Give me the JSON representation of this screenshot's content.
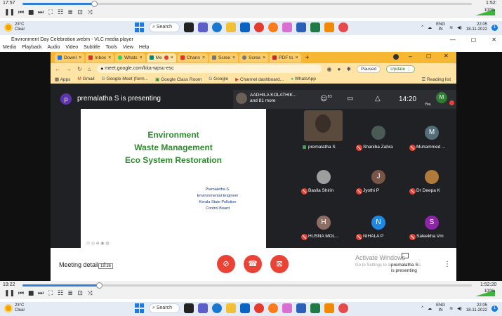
{
  "top_seek": {
    "elapsed": "17:57",
    "total": "1:52:",
    "progress": 0.16
  },
  "bottom_seek": {
    "elapsed": "19:22",
    "total": "1:52:20",
    "progress": 0.17
  },
  "volume": "100%",
  "vlc_controls": [
    "❚❚",
    "⏮",
    "■",
    "⏭",
    "⛶",
    "☷",
    "≣",
    "⊡",
    "⤨"
  ],
  "taskbar": {
    "weather_temp": "23°C",
    "weather_desc": "Clear",
    "search_label": "Search",
    "tray_lang_1": "ENG",
    "tray_lang_2": "IN",
    "clock_time": "22:05",
    "clock_date": "18-11-2022",
    "notif_count": "1"
  },
  "vlc": {
    "title": "Environment Day Celebration.webm - VLC media player",
    "menu": [
      "Media",
      "Playback",
      "Audio",
      "Video",
      "Subtitle",
      "Tools",
      "View",
      "Help"
    ],
    "win_minimize": "—",
    "win_restore": "▢",
    "win_close": "✕"
  },
  "browser": {
    "tabs": [
      "Downl",
      "Inbox",
      "Whats",
      "Me",
      "Chann",
      "Scree",
      "Scree",
      "PDF to"
    ],
    "tab_close": "×",
    "new_tab": "+",
    "url": "meet.google.com/kka-wpsu-esc",
    "paused_label": "Paused",
    "update_label": "Update",
    "bookmarks": [
      "Apps",
      "Gmail",
      "Google Meet (form...",
      "Google Class Room",
      "Google",
      "Channel dashboard...",
      "WhatsApp"
    ],
    "reading_list": "Reading list"
  },
  "meet": {
    "presenter_initial": "p",
    "presenter_label": "premalatha S is presenting",
    "top_speaker": "AADHILA KOLATHIK...",
    "top_speaker_more": "and 81 more",
    "participant_count": "83",
    "clock": "14:20",
    "you_initial": "M",
    "you_label": "You",
    "slide": {
      "title_1": "Environment",
      "title_2": "Waste Management",
      "title_3": "Eco System Restoration",
      "presenter": "Premaletha S.",
      "role": "Environmental Engineer",
      "org_1": "Kerala State Pollution",
      "org_2": "Control Board"
    },
    "participants": [
      {
        "name": "premalatha S",
        "initial": "",
        "color": "#6d5a4c"
      },
      {
        "name": "Shaniba Zahra",
        "initial": "",
        "color": "#4a5a55"
      },
      {
        "name": "Muhammed ...",
        "initial": "M",
        "color": "#546e7a"
      },
      {
        "name": "Basila Shirin",
        "initial": "",
        "color": "#9e9e9e"
      },
      {
        "name": "Jyothi P",
        "initial": "J",
        "color": "#795548"
      },
      {
        "name": "Dr Deepa K",
        "initial": "",
        "color": "#b07a3a"
      },
      {
        "name": "HUSNA MOL...",
        "initial": "H",
        "color": "#8d6e63"
      },
      {
        "name": "NIHALA P",
        "initial": "N",
        "color": "#1e88e5"
      },
      {
        "name": "Saleekha Vm",
        "initial": "S",
        "color": "#8e24aa"
      }
    ],
    "meeting_details": "Meeting details",
    "tooltip_time": "19:36",
    "activate_title": "Activate Windows",
    "activate_sub": "Go to Settings to activate Windows.",
    "presenting_tip_1": "premalatha S",
    "presenting_tip_2": "is presenting"
  }
}
